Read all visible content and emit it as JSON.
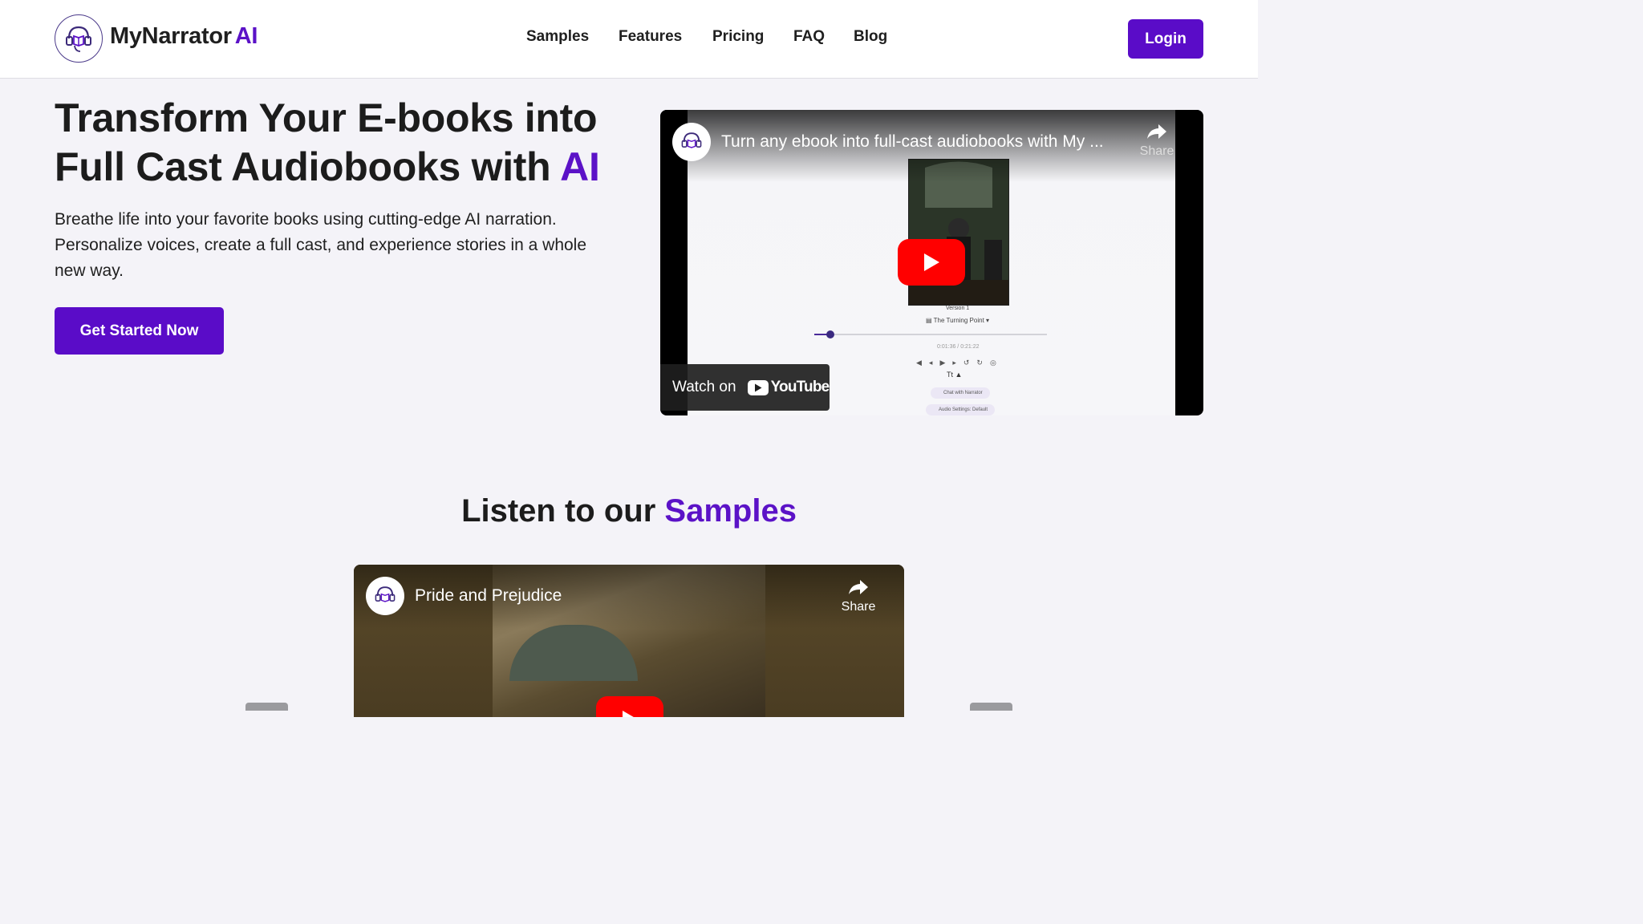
{
  "header": {
    "brand_name": "MyNarrator",
    "brand_suffix": "AI",
    "nav": [
      "Samples",
      "Features",
      "Pricing",
      "FAQ",
      "Blog"
    ],
    "login_label": "Login"
  },
  "hero": {
    "title_line1": "Transform Your E-books into",
    "title_line2": "Full Cast Audiobooks with",
    "title_accent": "AI",
    "subtitle": "Breathe life into your favorite books using cutting-edge AI narration. Personalize voices, create a full cast, and experience stories in a whole new way.",
    "cta_label": "Get Started Now"
  },
  "video1": {
    "title": "Turn any ebook into full-cast audiobooks with My ...",
    "share_label": "Share",
    "watch_on_label": "Watch on",
    "youtube_label": "YouTube",
    "book_version": "Version 1",
    "chapter": "The Turning Point",
    "time": "0:01:36 / 0:21:22",
    "chat_label": "Chat with Narrator",
    "audio_settings_label": "Audio Settings: Default",
    "progress_fraction": 0.07
  },
  "samples": {
    "title_prefix": "Listen to our",
    "title_accent": "Samples",
    "video_title": "Pride and Prejudice",
    "share_label": "Share"
  },
  "colors": {
    "accent": "#5b12c7",
    "button": "#5a0cc8",
    "background": "#f4f3f8",
    "youtube_red": "#ff0000"
  },
  "icons": {
    "logo": "headphones-book-icon",
    "share": "share-arrow-icon",
    "play": "play-icon"
  }
}
